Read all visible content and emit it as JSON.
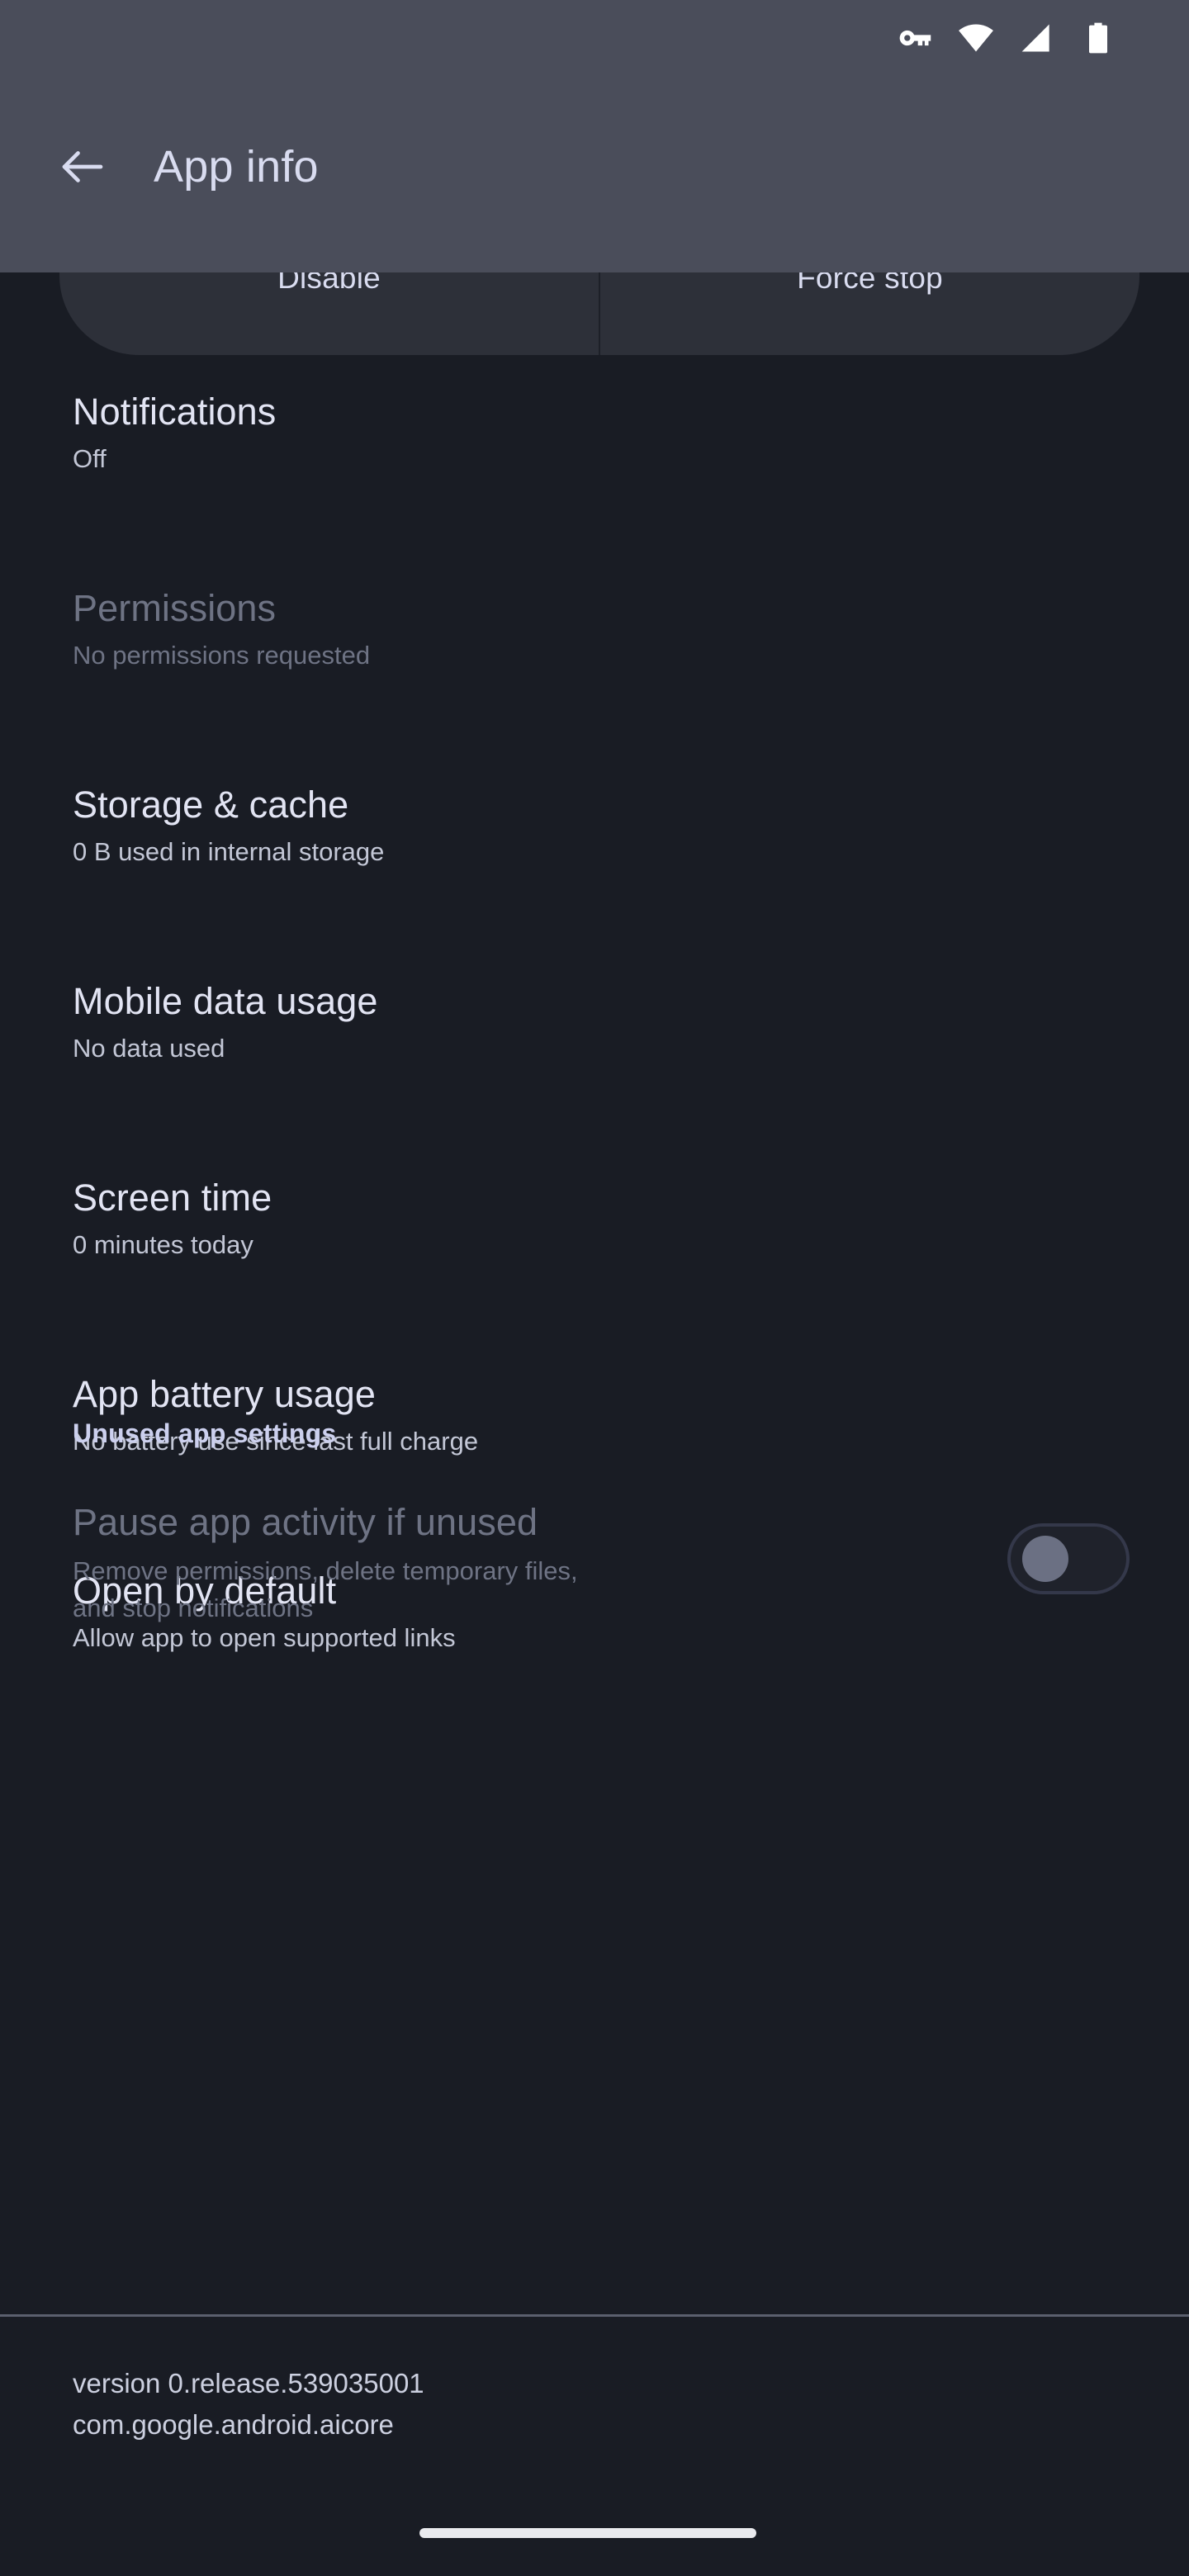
{
  "statusbar": {
    "icons": [
      {
        "name": "vpn-key-icon"
      },
      {
        "name": "wifi-icon"
      },
      {
        "name": "cellular-signal-icon"
      },
      {
        "name": "battery-icon"
      }
    ]
  },
  "appbar": {
    "back_icon": "back-arrow-icon",
    "title": "App info"
  },
  "actions": {
    "disable_label": "Disable",
    "force_stop_label": "Force stop"
  },
  "list": [
    {
      "title": "Notifications",
      "subtitle": "Off",
      "disabled": false
    },
    {
      "title": "Permissions",
      "subtitle": "No permissions requested",
      "disabled": true
    },
    {
      "title": "Storage & cache",
      "subtitle": "0 B used in internal storage",
      "disabled": false
    },
    {
      "title": "Mobile data usage",
      "subtitle": "No data used",
      "disabled": false
    },
    {
      "title": "Screen time",
      "subtitle": "0 minutes today",
      "disabled": false
    },
    {
      "title": "App battery usage",
      "subtitle": "No battery use since last full charge",
      "disabled": false
    },
    {
      "title": "Open by default",
      "subtitle": "Allow app to open supported links",
      "disabled": false
    }
  ],
  "unused_section": {
    "header": "Unused app settings",
    "toggle_title": "Pause app activity if unused",
    "toggle_sub_line1": "Remove permissions, delete temporary files,",
    "toggle_sub_line2": "and stop notifications",
    "toggle_state": "off"
  },
  "footer": {
    "version": "version 0.release.539035001",
    "package": "com.google.android.aicore"
  },
  "colors": {
    "page_background": "#191c24",
    "appbar_background": "#4a4d5a",
    "card_background": "#2d3039",
    "primary_text": "#e2e4f3",
    "secondary_text": "#c3c7d6",
    "disabled_text": "#6e7384",
    "accent_header": "#ccd0ee",
    "nav_pill": "#e9eaee"
  }
}
